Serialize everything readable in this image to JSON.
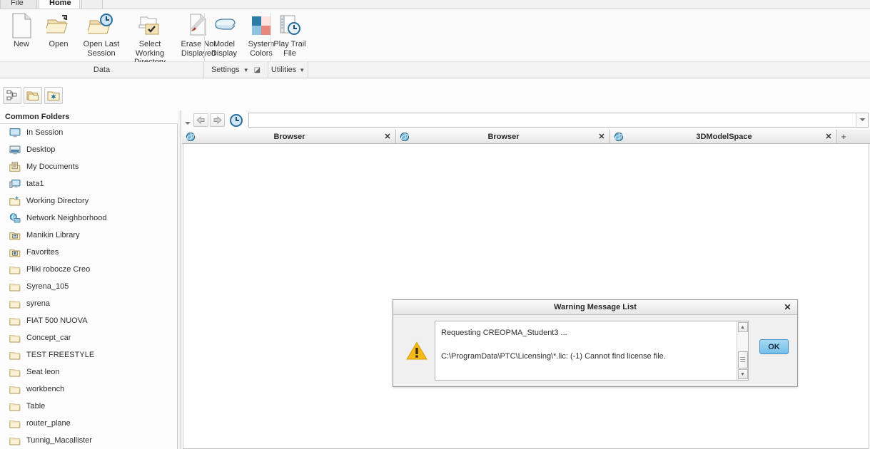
{
  "window": {
    "tabs": [
      {
        "label": "File"
      },
      {
        "label": "Home"
      },
      {
        "label": ""
      }
    ]
  },
  "ribbon": {
    "buttons": [
      {
        "label": "New",
        "icon": "new-document-icon"
      },
      {
        "label": "Open",
        "icon": "open-folder-icon"
      },
      {
        "label": "Open Last Session",
        "icon": "open-last-session-icon"
      },
      {
        "label": "Select Working Directory",
        "icon": "select-working-directory-icon"
      },
      {
        "label": "Erase Not Displayed",
        "icon": "erase-not-displayed-icon"
      },
      {
        "label": "Model Display",
        "icon": "model-display-icon"
      },
      {
        "label": "System Colors",
        "icon": "system-colors-icon"
      },
      {
        "label": "Play Trail File",
        "icon": "play-trail-file-icon"
      }
    ],
    "groups": {
      "data": "Data",
      "settings": "Settings",
      "utilities": "Utilities",
      "caret": "▼",
      "launcher": "◪"
    }
  },
  "quick_toolbar": {
    "buttons": [
      {
        "name": "tree-view-button",
        "icon": "hierarchy-tree-icon"
      },
      {
        "name": "folder-browser-button",
        "icon": "folders-stack-icon"
      },
      {
        "name": "favorites-button",
        "icon": "favorites-folder-icon"
      }
    ]
  },
  "sidebar": {
    "title": "Common Folders",
    "items": [
      {
        "label": "In Session",
        "icon": "monitor-icon"
      },
      {
        "label": "Desktop",
        "icon": "desktop-icon"
      },
      {
        "label": "My Documents",
        "icon": "documents-folder-icon"
      },
      {
        "label": "tata1",
        "icon": "computer-icon"
      },
      {
        "label": "Working Directory",
        "icon": "working-directory-icon"
      },
      {
        "label": "Network Neighborhood",
        "icon": "network-globe-icon"
      },
      {
        "label": "Manikin Library",
        "icon": "manikin-library-icon"
      },
      {
        "label": "Favorites",
        "icon": "favorites-star-icon"
      },
      {
        "label": "Pliki robocze Creo",
        "icon": "folder-icon"
      },
      {
        "label": "Syrena_105",
        "icon": "folder-icon"
      },
      {
        "label": "syrena",
        "icon": "folder-icon"
      },
      {
        "label": "FIAT 500 NUOVA",
        "icon": "folder-icon"
      },
      {
        "label": "Concept_car",
        "icon": "folder-icon"
      },
      {
        "label": "TEST FREESTYLE",
        "icon": "folder-icon"
      },
      {
        "label": "Seat leon",
        "icon": "folder-icon"
      },
      {
        "label": "workbench",
        "icon": "folder-icon"
      },
      {
        "label": "Table",
        "icon": "folder-icon"
      },
      {
        "label": "router_plane",
        "icon": "folder-icon"
      },
      {
        "label": "Tunnig_Macallister",
        "icon": "folder-icon"
      }
    ]
  },
  "browser": {
    "nav": {
      "back_icon": "back-arrow-icon",
      "forward_icon": "forward-arrow-icon",
      "history_icon": "history-clock-icon",
      "collapse_icon": "chevron-down-icon",
      "address_value": "",
      "address_placeholder": "",
      "dropdown_icon": "chevron-down-icon"
    },
    "tabs": [
      {
        "label": "Browser",
        "icon": "browser-globe-icon",
        "close": "✕"
      },
      {
        "label": "Browser",
        "icon": "browser-globe-icon",
        "close": "✕"
      },
      {
        "label": "3DModelSpace",
        "icon": "browser-globe-icon",
        "close": "✕"
      }
    ],
    "add_tab": "+"
  },
  "dialog": {
    "title": "Warning Message List",
    "close": "✕",
    "warning_icon": "warning-triangle-icon",
    "messages": [
      "Requesting CREOPMA_Student3 ...",
      "C:\\ProgramData\\PTC\\Licensing\\*.lic: (-1) Cannot find license file."
    ],
    "scroll": {
      "up": "▲",
      "down": "▼"
    },
    "ok_label": "OK"
  },
  "colors": {
    "accent_blue": "#74bfe8",
    "warning_amber": "#f5b91a",
    "folder_tan": "#e8d9ab",
    "chrome_gray": "#f3f3f3"
  }
}
